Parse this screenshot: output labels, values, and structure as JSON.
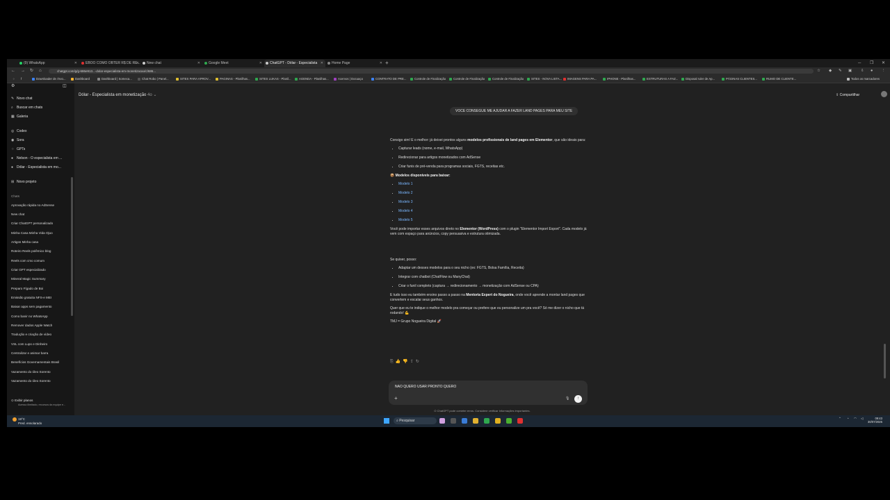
{
  "browser": {
    "tabs": [
      {
        "label": "(9) WhatsApp",
        "color": "#25d366"
      },
      {
        "label": "EBOO COMO OBTER R$ DE RE...",
        "color": "#e03030"
      },
      {
        "label": "New chat",
        "color": "#cccccc"
      },
      {
        "label": "Google Meet",
        "color": "#2fa84f"
      },
      {
        "label": "ChatGPT - Dólar - Especialista",
        "color": "#cccccc"
      },
      {
        "label": "Home Page",
        "color": "#888888"
      }
    ],
    "url": "chatgpt.com/g/g-686e913...-dolar-especialista-em-monetizacao/c/686...",
    "bookmarks": [
      {
        "label": "Downloader de Árvo...",
        "color": "#3b82f6"
      },
      {
        "label": "Dashboard",
        "color": "#f0b030"
      },
      {
        "label": "Dashboard | Someca...",
        "color": "#888"
      },
      {
        "label": "Chat Robo | Panel...",
        "color": "#555"
      },
      {
        "label": "SITES PARA APROV...",
        "color": "#e0c030"
      },
      {
        "label": "PAGINAS - Planilhas...",
        "color": "#e0c030"
      },
      {
        "label": "SITES LUKAS - Planil...",
        "color": "#2fa84f"
      },
      {
        "label": "AGENDA - Planilhas...",
        "color": "#2fa84f"
      },
      {
        "label": "Acervos | Docuaço",
        "color": "#a040c0"
      },
      {
        "label": "CONTRATO DE PRE...",
        "color": "#3b82f6"
      },
      {
        "label": "Controle de Finalização",
        "color": "#2fa84f"
      },
      {
        "label": "Controle de Finalização",
        "color": "#2fa84f"
      },
      {
        "label": "Controle de Finalização",
        "color": "#2fa84f"
      },
      {
        "label": "SITES - NOVA LISTA...",
        "color": "#2fa84f"
      },
      {
        "label": "IMAGENS PARA PA...",
        "color": "#e03030"
      },
      {
        "label": "IPHONE - Planilhas...",
        "color": "#2fa84f"
      },
      {
        "label": "ESTRUTURAS A FAZ...",
        "color": "#2fa84f"
      },
      {
        "label": "Disposal ruler de Ap...",
        "color": "#2fa84f"
      },
      {
        "label": "PÁGINAS CLIENTES...",
        "color": "#2fa84f"
      },
      {
        "label": "RUMO DE CLIENTE...",
        "color": "#2fa84f"
      }
    ],
    "all_bookmarks": "Todos os marcadores"
  },
  "sidebar": {
    "top_items": [
      {
        "icon": "new-chat-icon",
        "glyph": "✎",
        "label": "Novo chat"
      },
      {
        "icon": "search-icon",
        "glyph": "⌕",
        "label": "Buscar em chats"
      },
      {
        "icon": "gallery-icon",
        "glyph": "▦",
        "label": "Galeria"
      }
    ],
    "tools": [
      {
        "icon": "codex-icon",
        "glyph": "◎",
        "label": "Codex"
      },
      {
        "icon": "sora-icon",
        "glyph": "◉",
        "label": "Sora"
      },
      {
        "icon": "gpts-icon",
        "glyph": "⁘",
        "label": "GPTs"
      },
      {
        "icon": "gpt-avatar-icon",
        "glyph": "●",
        "label": "Nelson - O especialista em ..."
      },
      {
        "icon": "gpt-avatar-icon",
        "glyph": "●",
        "label": "Dólar - Especialista em mo..."
      }
    ],
    "new_project": "Novo projeto",
    "chats_heading": "Chats",
    "chats": [
      "Aprovação rápida no AdSense",
      "New chat",
      "Criar ChatGPT personalizado",
      "Minha Casa Minha Vida Ojuo",
      "Artigos Minha casa",
      "Roteiro Reels polêmico blog",
      "Reels com cmo comum",
      "Criar GPT especializado",
      "Mineral Magic Summary",
      "Preparo Fígado de Boi",
      "Emissão gratuita NFS-e MEI",
      "Baixar apps sem pagamento",
      "Como banir no WhatsApp",
      "Remover dados Apple Watch",
      "Tradução e criação de vídeo",
      "VSL com Lupo e Dinheiro",
      "Centralizar e animar barra",
      "Benefícios Governamentais Brasil",
      "Vazamento do óleo Sorento",
      "Vazamento do óleo Sorento"
    ],
    "footer_title": "Exibir planos",
    "footer_sub": "Acesso ilimitado, recursos da equipe e..."
  },
  "header": {
    "model": "Dólar - Especialista em monetização",
    "model_version": "4o ⌄",
    "share": "Compartilhar"
  },
  "conversation": {
    "user_message": "VOCE CONSEGUE ME AJUDAR A FAZER LAND PAGES PARA MEU SITE",
    "intro_a": "Consigo sim! E o melhor: já deixei prontos alguns ",
    "intro_b": "modelos profissionais de land pages em Elementor",
    "intro_c": ", que são ideais para:",
    "uses": [
      "Capturar leads (nome, e-mail, WhatsApp)",
      "Redirecionar para artigos monetizados com AdSense",
      "Criar funis de pré-venda para programas sociais, FGTS, receitas etc."
    ],
    "models_heading": "📦 Modelos disponíveis para baixar:",
    "models": [
      "Modelo 1",
      "Modelo 2",
      "Modelo 3",
      "Modelo 4",
      "Modelo 5"
    ],
    "import_a": "Você pode importar esses arquivos direto no ",
    "import_b": "Elementor (WordPress)",
    "import_c": " com o plugin \"Elementor Import Export\". Cada modelo já vem com espaço para anúncios, copy persuasiva e estrutura otimizada.",
    "options_intro": "Se quiser, posso:",
    "options": [
      "Adaptar um desses modelos para o seu nicho (ex: FGTS, Bolsa Família, Receita)",
      "Integrar com chatbot (ChatFlow ou ManyChat)",
      "Criar o funil completo (captura → redirecionamento → monetização com AdSense ou CPA)"
    ],
    "mentoria_a": "E tudo isso eu também ensino passo a passo na ",
    "mentoria_b": "Mentoria Expert do Nogueira",
    "mentoria_c": ", onde você aprende a montar land pages que convertem e escalar seus ganhos.",
    "question": "Quer que eu te indique o melhor modelo pra começar ou prefere que eu personalize um pra você? Só me dizer o nicho que tá rodando! 💪",
    "signature": "TMJ = Grupo Nogueira Digital 🚀"
  },
  "composer": {
    "text": "NAO QUERO USAR PRONTO QUERO",
    "disclaimer": "O ChatGPT pode cometer erros. Considere verificar informações importantes."
  },
  "taskbar": {
    "temp": "19°C",
    "weather": "Pred. ensolarado",
    "search": "Pesquisar",
    "app_colors": [
      "#d0a0e0",
      "#444",
      "#3a7bd5",
      "#e0b030",
      "#2fa84f",
      "#e0b020",
      "#4ab030",
      "#e03030"
    ],
    "time": "09:43",
    "date": "30/07/2025"
  }
}
